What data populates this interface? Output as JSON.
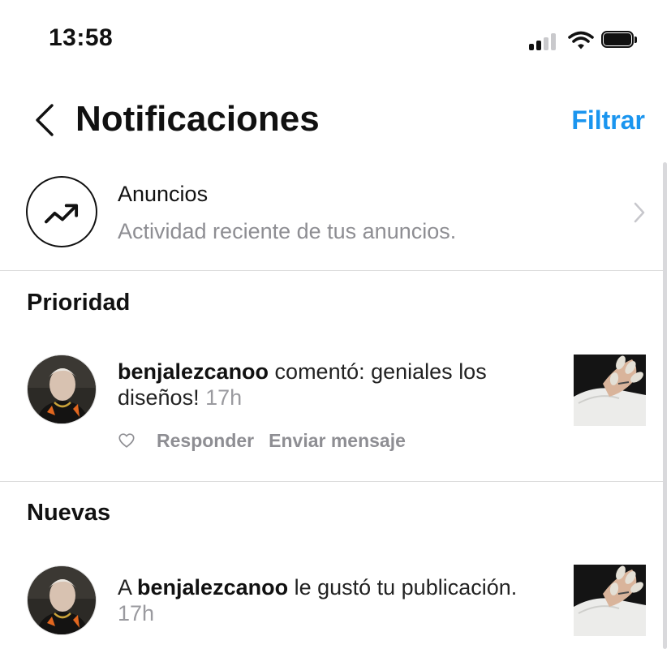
{
  "status_bar": {
    "time": "13:58",
    "icons": [
      "cellular-signal-icon",
      "wifi-icon",
      "battery-icon"
    ]
  },
  "header": {
    "back_icon": "chevron-left-icon",
    "title": "Notificaciones",
    "filter_label": "Filtrar"
  },
  "ads": {
    "icon": "trending-up-icon",
    "title": "Anuncios",
    "subtitle": "Actividad reciente de tus anuncios.",
    "chevron_icon": "chevron-right-icon"
  },
  "priority": {
    "section_title": "Prioridad",
    "items": [
      {
        "username": "benjalezcanoo",
        "text": " comentó: geniales los diseños!",
        "time": "17h",
        "actions": {
          "like_icon": "heart-outline-icon",
          "reply_label": "Responder",
          "message_label": "Enviar mensaje"
        }
      }
    ]
  },
  "new": {
    "section_title": "Nuevas",
    "items": [
      {
        "prefix": "A ",
        "username": "benjalezcanoo",
        "text": " le gustó tu publicación.",
        "time": "17h"
      }
    ]
  },
  "colors": {
    "accent": "#1a95ef",
    "muted_text": "#8e8e93",
    "divider": "#dcdcdc"
  }
}
